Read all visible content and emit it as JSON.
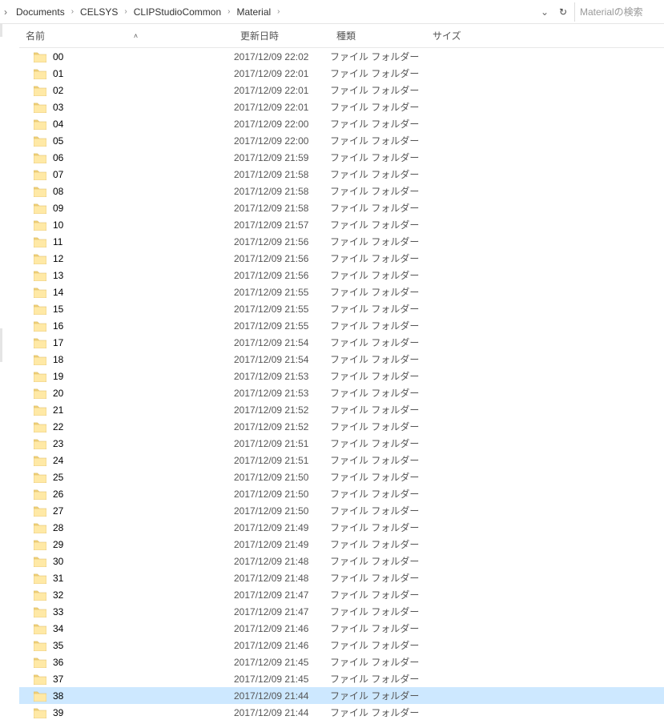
{
  "breadcrumb": {
    "items": [
      "Documents",
      "CELSYS",
      "CLIPStudioCommon",
      "Material"
    ]
  },
  "search": {
    "placeholder": "Materialの検索"
  },
  "columns": {
    "name": "名前",
    "date": "更新日時",
    "type": "種類",
    "size": "サイズ",
    "sorted": "name",
    "sort_dir": "asc"
  },
  "selected_index": 38,
  "rows": [
    {
      "name": "00",
      "date": "2017/12/09 22:02",
      "type": "ファイル フォルダー",
      "size": ""
    },
    {
      "name": "01",
      "date": "2017/12/09 22:01",
      "type": "ファイル フォルダー",
      "size": ""
    },
    {
      "name": "02",
      "date": "2017/12/09 22:01",
      "type": "ファイル フォルダー",
      "size": ""
    },
    {
      "name": "03",
      "date": "2017/12/09 22:01",
      "type": "ファイル フォルダー",
      "size": ""
    },
    {
      "name": "04",
      "date": "2017/12/09 22:00",
      "type": "ファイル フォルダー",
      "size": ""
    },
    {
      "name": "05",
      "date": "2017/12/09 22:00",
      "type": "ファイル フォルダー",
      "size": ""
    },
    {
      "name": "06",
      "date": "2017/12/09 21:59",
      "type": "ファイル フォルダー",
      "size": ""
    },
    {
      "name": "07",
      "date": "2017/12/09 21:58",
      "type": "ファイル フォルダー",
      "size": ""
    },
    {
      "name": "08",
      "date": "2017/12/09 21:58",
      "type": "ファイル フォルダー",
      "size": ""
    },
    {
      "name": "09",
      "date": "2017/12/09 21:58",
      "type": "ファイル フォルダー",
      "size": ""
    },
    {
      "name": "10",
      "date": "2017/12/09 21:57",
      "type": "ファイル フォルダー",
      "size": ""
    },
    {
      "name": "11",
      "date": "2017/12/09 21:56",
      "type": "ファイル フォルダー",
      "size": ""
    },
    {
      "name": "12",
      "date": "2017/12/09 21:56",
      "type": "ファイル フォルダー",
      "size": ""
    },
    {
      "name": "13",
      "date": "2017/12/09 21:56",
      "type": "ファイル フォルダー",
      "size": ""
    },
    {
      "name": "14",
      "date": "2017/12/09 21:55",
      "type": "ファイル フォルダー",
      "size": ""
    },
    {
      "name": "15",
      "date": "2017/12/09 21:55",
      "type": "ファイル フォルダー",
      "size": ""
    },
    {
      "name": "16",
      "date": "2017/12/09 21:55",
      "type": "ファイル フォルダー",
      "size": ""
    },
    {
      "name": "17",
      "date": "2017/12/09 21:54",
      "type": "ファイル フォルダー",
      "size": ""
    },
    {
      "name": "18",
      "date": "2017/12/09 21:54",
      "type": "ファイル フォルダー",
      "size": ""
    },
    {
      "name": "19",
      "date": "2017/12/09 21:53",
      "type": "ファイル フォルダー",
      "size": ""
    },
    {
      "name": "20",
      "date": "2017/12/09 21:53",
      "type": "ファイル フォルダー",
      "size": ""
    },
    {
      "name": "21",
      "date": "2017/12/09 21:52",
      "type": "ファイル フォルダー",
      "size": ""
    },
    {
      "name": "22",
      "date": "2017/12/09 21:52",
      "type": "ファイル フォルダー",
      "size": ""
    },
    {
      "name": "23",
      "date": "2017/12/09 21:51",
      "type": "ファイル フォルダー",
      "size": ""
    },
    {
      "name": "24",
      "date": "2017/12/09 21:51",
      "type": "ファイル フォルダー",
      "size": ""
    },
    {
      "name": "25",
      "date": "2017/12/09 21:50",
      "type": "ファイル フォルダー",
      "size": ""
    },
    {
      "name": "26",
      "date": "2017/12/09 21:50",
      "type": "ファイル フォルダー",
      "size": ""
    },
    {
      "name": "27",
      "date": "2017/12/09 21:50",
      "type": "ファイル フォルダー",
      "size": ""
    },
    {
      "name": "28",
      "date": "2017/12/09 21:49",
      "type": "ファイル フォルダー",
      "size": ""
    },
    {
      "name": "29",
      "date": "2017/12/09 21:49",
      "type": "ファイル フォルダー",
      "size": ""
    },
    {
      "name": "30",
      "date": "2017/12/09 21:48",
      "type": "ファイル フォルダー",
      "size": ""
    },
    {
      "name": "31",
      "date": "2017/12/09 21:48",
      "type": "ファイル フォルダー",
      "size": ""
    },
    {
      "name": "32",
      "date": "2017/12/09 21:47",
      "type": "ファイル フォルダー",
      "size": ""
    },
    {
      "name": "33",
      "date": "2017/12/09 21:47",
      "type": "ファイル フォルダー",
      "size": ""
    },
    {
      "name": "34",
      "date": "2017/12/09 21:46",
      "type": "ファイル フォルダー",
      "size": ""
    },
    {
      "name": "35",
      "date": "2017/12/09 21:46",
      "type": "ファイル フォルダー",
      "size": ""
    },
    {
      "name": "36",
      "date": "2017/12/09 21:45",
      "type": "ファイル フォルダー",
      "size": ""
    },
    {
      "name": "37",
      "date": "2017/12/09 21:45",
      "type": "ファイル フォルダー",
      "size": ""
    },
    {
      "name": "38",
      "date": "2017/12/09 21:44",
      "type": "ファイル フォルダー",
      "size": ""
    },
    {
      "name": "39",
      "date": "2017/12/09 21:44",
      "type": "ファイル フォルダー",
      "size": ""
    }
  ],
  "icons": {
    "folder": "folder-icon",
    "refresh": "refresh-icon",
    "chevron-right": "chevron-right-icon",
    "chevron-down": "chevron-down-icon"
  }
}
